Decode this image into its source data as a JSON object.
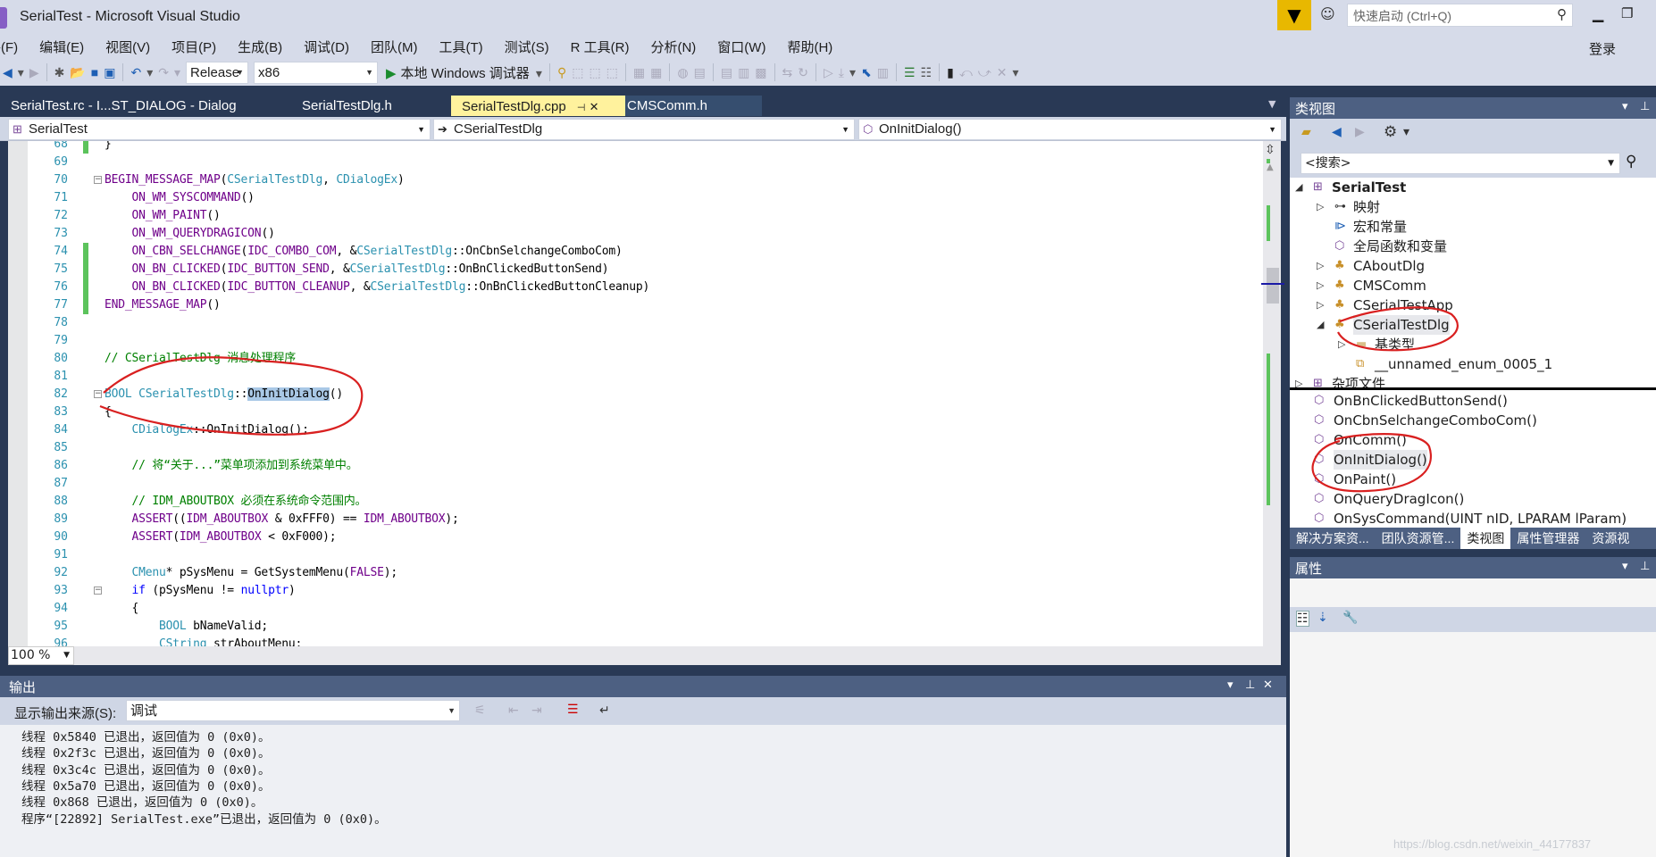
{
  "window": {
    "title": "SerialTest - Microsoft Visual Studio",
    "quick_launch_placeholder": "快速启动 (Ctrl+Q)",
    "login": "登录"
  },
  "menu": [
    "件(F)",
    "编辑(E)",
    "视图(V)",
    "项目(P)",
    "生成(B)",
    "调试(D)",
    "团队(M)",
    "工具(T)",
    "测试(S)",
    "R 工具(R)",
    "分析(N)",
    "窗口(W)",
    "帮助(H)"
  ],
  "toolbar": {
    "configuration": "Release",
    "platform": "x86",
    "run_label": "本地 Windows 调试器"
  },
  "tabs": [
    {
      "label": "SerialTest.rc - I...ST_DIALOG - Dialog",
      "active": false
    },
    {
      "label": "SerialTestDlg.h",
      "active": false
    },
    {
      "label": "SerialTestDlg.cpp",
      "active": true
    },
    {
      "label": "CMSComm.h",
      "active": false
    }
  ],
  "navbar": {
    "project": "SerialTest",
    "class": "CSerialTestDlg",
    "member": "OnInitDialog()"
  },
  "editor": {
    "zoom": "100 %",
    "lines": [
      {
        "n": "68",
        "changed": true,
        "tokens": [
          [
            "}",
            ""
          ]
        ]
      },
      {
        "n": "69",
        "tokens": []
      },
      {
        "n": "70",
        "fold": true,
        "tokens": [
          [
            "BEGIN_MESSAGE_MAP",
            "mac"
          ],
          [
            "(",
            ""
          ],
          [
            "CSerialTestDlg",
            "type"
          ],
          [
            ", ",
            ""
          ],
          [
            "CDialogEx",
            "type"
          ],
          [
            ")",
            ""
          ]
        ]
      },
      {
        "n": "71",
        "tokens": [
          [
            "    ",
            ""
          ],
          [
            "ON_WM_SYSCOMMAND",
            "mac"
          ],
          [
            "()",
            ""
          ]
        ]
      },
      {
        "n": "72",
        "tokens": [
          [
            "    ",
            ""
          ],
          [
            "ON_WM_PAINT",
            "mac"
          ],
          [
            "()",
            ""
          ]
        ]
      },
      {
        "n": "73",
        "tokens": [
          [
            "    ",
            ""
          ],
          [
            "ON_WM_QUERYDRAGICON",
            "mac"
          ],
          [
            "()",
            ""
          ]
        ]
      },
      {
        "n": "74",
        "changed": true,
        "tokens": [
          [
            "    ",
            ""
          ],
          [
            "ON_CBN_SELCHANGE",
            "mac"
          ],
          [
            "(",
            ""
          ],
          [
            "IDC_COMBO_COM",
            "mac"
          ],
          [
            ", &",
            ""
          ],
          [
            "CSerialTestDlg",
            "type"
          ],
          [
            "::OnCbnSelchangeComboCom)",
            ""
          ]
        ]
      },
      {
        "n": "75",
        "changed": true,
        "tokens": [
          [
            "    ",
            ""
          ],
          [
            "ON_BN_CLICKED",
            "mac"
          ],
          [
            "(",
            ""
          ],
          [
            "IDC_BUTTON_SEND",
            "mac"
          ],
          [
            ", &",
            ""
          ],
          [
            "CSerialTestDlg",
            "type"
          ],
          [
            "::OnBnClickedButtonSend)",
            ""
          ]
        ]
      },
      {
        "n": "76",
        "changed": true,
        "tokens": [
          [
            "    ",
            ""
          ],
          [
            "ON_BN_CLICKED",
            "mac"
          ],
          [
            "(",
            ""
          ],
          [
            "IDC_BUTTON_CLEANUP",
            "mac"
          ],
          [
            ", &",
            ""
          ],
          [
            "CSerialTestDlg",
            "type"
          ],
          [
            "::OnBnClickedButtonCleanup)",
            ""
          ]
        ]
      },
      {
        "n": "77",
        "changed": true,
        "tokens": [
          [
            "END_MESSAGE_MAP",
            "mac"
          ],
          [
            "()",
            ""
          ]
        ]
      },
      {
        "n": "78",
        "tokens": []
      },
      {
        "n": "79",
        "tokens": []
      },
      {
        "n": "80",
        "tokens": [
          [
            "// CSerialTestDlg 消息处理程序",
            "cmt"
          ]
        ]
      },
      {
        "n": "81",
        "tokens": []
      },
      {
        "n": "82",
        "fold": true,
        "tokens": [
          [
            "BOOL",
            "type"
          ],
          [
            " ",
            ""
          ],
          [
            "CSerialTestDlg",
            "type"
          ],
          [
            "::",
            ""
          ],
          [
            "OnInitDialog",
            "hl"
          ],
          [
            "()",
            ""
          ]
        ]
      },
      {
        "n": "83",
        "tokens": [
          [
            "{",
            ""
          ]
        ]
      },
      {
        "n": "84",
        "tokens": [
          [
            "    ",
            ""
          ],
          [
            "CDialogEx",
            "type"
          ],
          [
            "::OnInitDialog();",
            ""
          ]
        ]
      },
      {
        "n": "85",
        "tokens": []
      },
      {
        "n": "86",
        "tokens": [
          [
            "    ",
            ""
          ],
          [
            "// 将“关于...”菜单项添加到系统菜单中。",
            "cmt"
          ]
        ]
      },
      {
        "n": "87",
        "tokens": []
      },
      {
        "n": "88",
        "tokens": [
          [
            "    ",
            ""
          ],
          [
            "// IDM_ABOUTBOX 必须在系统命令范围内。",
            "cmt"
          ]
        ]
      },
      {
        "n": "89",
        "tokens": [
          [
            "    ",
            ""
          ],
          [
            "ASSERT",
            "mac"
          ],
          [
            "((",
            ""
          ],
          [
            "IDM_ABOUTBOX",
            "mac"
          ],
          [
            " & 0xFFF0) == ",
            ""
          ],
          [
            "IDM_ABOUTBOX",
            "mac"
          ],
          [
            ");",
            ""
          ]
        ]
      },
      {
        "n": "90",
        "tokens": [
          [
            "    ",
            ""
          ],
          [
            "ASSERT",
            "mac"
          ],
          [
            "(",
            ""
          ],
          [
            "IDM_ABOUTBOX",
            "mac"
          ],
          [
            " < 0xF000);",
            ""
          ]
        ]
      },
      {
        "n": "91",
        "tokens": []
      },
      {
        "n": "92",
        "tokens": [
          [
            "    ",
            ""
          ],
          [
            "CMenu",
            "type"
          ],
          [
            "* pSysMenu = GetSystemMenu(",
            ""
          ],
          [
            "FALSE",
            "mac"
          ],
          [
            ");",
            ""
          ]
        ]
      },
      {
        "n": "93",
        "fold": true,
        "tokens": [
          [
            "    ",
            ""
          ],
          [
            "if",
            "kw"
          ],
          [
            " (pSysMenu != ",
            ""
          ],
          [
            "nullptr",
            "kw"
          ],
          [
            ")",
            ""
          ]
        ]
      },
      {
        "n": "94",
        "tokens": [
          [
            "    {",
            ""
          ]
        ]
      },
      {
        "n": "95",
        "tokens": [
          [
            "        ",
            ""
          ],
          [
            "BOOL",
            "type"
          ],
          [
            " bNameValid;",
            ""
          ]
        ]
      },
      {
        "n": "96",
        "tokens": [
          [
            "        ",
            ""
          ],
          [
            "CString",
            "type"
          ],
          [
            " strAboutMenu;",
            ""
          ]
        ]
      }
    ]
  },
  "output": {
    "title": "输出",
    "source_label": "显示输出来源(S):",
    "source_value": "调试",
    "lines": [
      "线程 0x5840 已退出，返回值为 0 (0x0)。",
      "线程 0x2f3c 已退出，返回值为 0 (0x0)。",
      "线程 0x3c4c 已退出，返回值为 0 (0x0)。",
      "线程 0x5a70 已退出，返回值为 0 (0x0)。",
      "线程 0x868 已退出，返回值为 0 (0x0)。",
      "程序“[22892] SerialTest.exe”已退出，返回值为 0 (0x0)。"
    ]
  },
  "class_view": {
    "title": "类视图",
    "search_placeholder": "<搜索>",
    "tree": [
      {
        "label": "SerialTest",
        "level": 0,
        "expander": "expanded",
        "icon": "project-icon",
        "bold": true
      },
      {
        "label": "映射",
        "level": 1,
        "expander": "collapsed",
        "icon": "map-icon"
      },
      {
        "label": "宏和常量",
        "level": 1,
        "expander": "none",
        "icon": "macro-icon"
      },
      {
        "label": "全局函数和变量",
        "level": 1,
        "expander": "none",
        "icon": "global-icon"
      },
      {
        "label": "CAboutDlg",
        "level": 1,
        "expander": "collapsed",
        "icon": "class-icon"
      },
      {
        "label": "CMSComm",
        "level": 1,
        "expander": "collapsed",
        "icon": "class-icon"
      },
      {
        "label": "CSerialTestApp",
        "level": 1,
        "expander": "collapsed",
        "icon": "class-icon"
      },
      {
        "label": "CSerialTestDlg",
        "level": 1,
        "expander": "expanded",
        "icon": "class-icon",
        "selected": true
      },
      {
        "label": "基类型",
        "level": 2,
        "expander": "collapsed",
        "icon": "folder-icon"
      },
      {
        "label": "__unnamed_enum_0005_1",
        "level": 2,
        "expander": "none",
        "icon": "enum-icon"
      },
      {
        "label": "杂项文件",
        "level": 0,
        "expander": "collapsed",
        "icon": "project-icon"
      }
    ],
    "members": [
      "OnBnClickedButtonSend()",
      "OnCbnSelchangeComboCom()",
      "OnComm()",
      "OnInitDialog()",
      "OnPaint()",
      "OnQueryDragIcon()",
      "OnSysCommand(UINT nID, LPARAM lParam)"
    ],
    "selected_member": "OnInitDialog()"
  },
  "bottom_tabs": [
    {
      "label": "解决方案资...",
      "active": false
    },
    {
      "label": "团队资源管...",
      "active": false
    },
    {
      "label": "类视图",
      "active": true
    },
    {
      "label": "属性管理器",
      "active": false
    },
    {
      "label": "资源视",
      "active": false
    }
  ],
  "properties": {
    "title": "属性"
  },
  "watermark": "https://blog.csdn.net/weixin_44177837",
  "colors": {
    "accent_tab": "#fff29d",
    "annotation": "#d92020",
    "frame": "#293955",
    "header": "#4d6082"
  }
}
